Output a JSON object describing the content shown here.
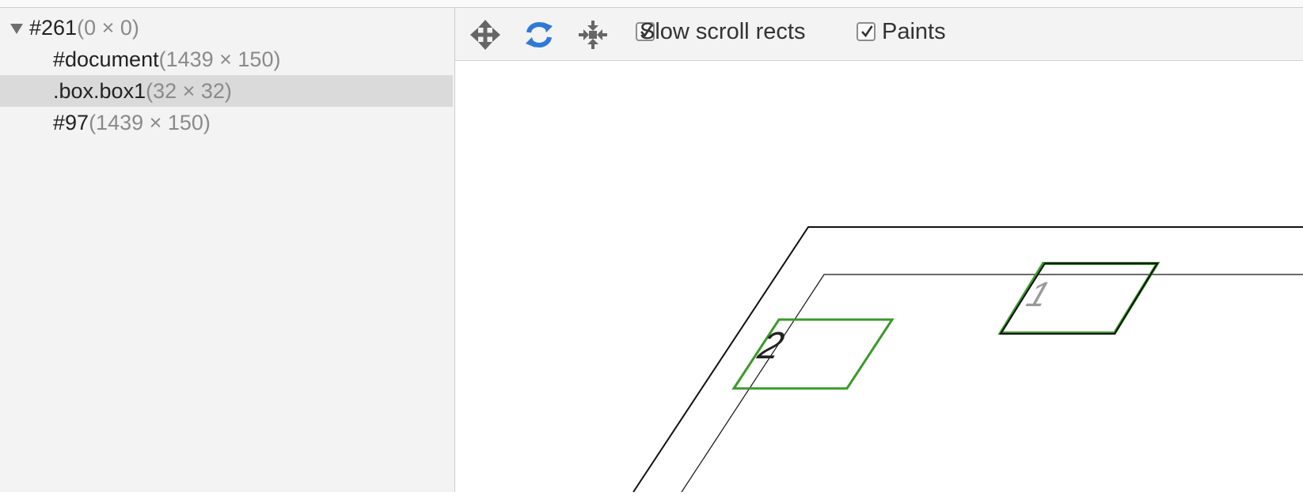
{
  "layer_tree": {
    "root": {
      "name": "#261",
      "dims": "(0 × 0)"
    },
    "children": [
      {
        "name": "#document",
        "dims": "(1439 × 150)"
      },
      {
        "name": ".box.box1",
        "dims": "(32 × 32)",
        "selected": true
      },
      {
        "name": "#97",
        "dims": "(1439 × 150)"
      }
    ]
  },
  "toolbar": {
    "pan_icon": "pan-arrows-icon",
    "rotate_icon": "rotate-icon",
    "reset_icon": "reset-transform-icon",
    "rotate_active_color": "#2f7ad8",
    "slow_scroll_rects": {
      "label": "Slow scroll rects",
      "checked": true
    },
    "paints": {
      "label": "Paints",
      "checked": true
    }
  },
  "view": {
    "box_1_label": "1",
    "box_2_label": "2",
    "paint_color": "#3a9a2a"
  }
}
